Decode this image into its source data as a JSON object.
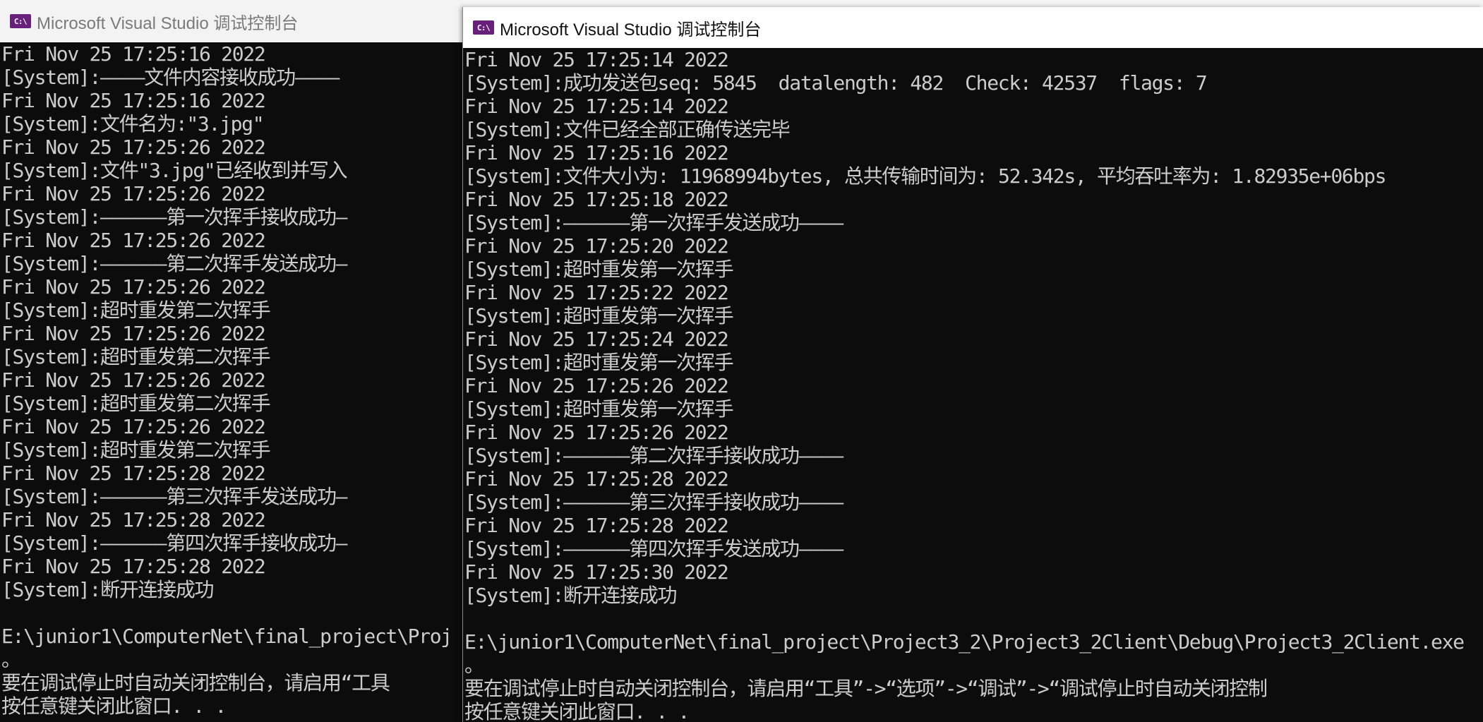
{
  "left_window": {
    "title": "Microsoft Visual Studio 调试控制台",
    "icon": "c-console-icon",
    "lines": [
      "Fri Nov 25 17:25:16 2022",
      "[System]:————文件内容接收成功————",
      "Fri Nov 25 17:25:16 2022",
      "[System]:文件名为:\"3.jpg\"",
      "Fri Nov 25 17:25:26 2022",
      "[System]:文件\"3.jpg\"已经收到并写入",
      "Fri Nov 25 17:25:26 2022",
      "[System]:——————第一次挥手接收成功—",
      "Fri Nov 25 17:25:26 2022",
      "[System]:——————第二次挥手发送成功—",
      "Fri Nov 25 17:25:26 2022",
      "[System]:超时重发第二次挥手",
      "Fri Nov 25 17:25:26 2022",
      "[System]:超时重发第二次挥手",
      "Fri Nov 25 17:25:26 2022",
      "[System]:超时重发第二次挥手",
      "Fri Nov 25 17:25:26 2022",
      "[System]:超时重发第二次挥手",
      "Fri Nov 25 17:25:28 2022",
      "[System]:——————第三次挥手发送成功—",
      "Fri Nov 25 17:25:28 2022",
      "[System]:——————第四次挥手接收成功—",
      "Fri Nov 25 17:25:28 2022",
      "[System]:断开连接成功",
      "",
      "E:\\junior1\\ComputerNet\\final_project\\Proj",
      "。",
      "要在调试停止时自动关闭控制台，请启用“工具",
      "按任意键关闭此窗口. . ."
    ]
  },
  "right_window": {
    "title": "Microsoft Visual Studio 调试控制台",
    "icon": "c-console-icon",
    "lines": [
      "Fri Nov 25 17:25:14 2022",
      "[System]:成功发送包seq: 5845  datalength: 482  Check: 42537  flags: 7",
      "Fri Nov 25 17:25:14 2022",
      "[System]:文件已经全部正确传送完毕",
      "Fri Nov 25 17:25:16 2022",
      "[System]:文件大小为: 11968994bytes, 总共传输时间为: 52.342s, 平均吞吐率为: 1.82935e+06bps",
      "Fri Nov 25 17:25:18 2022",
      "[System]:——————第一次挥手发送成功————",
      "Fri Nov 25 17:25:20 2022",
      "[System]:超时重发第一次挥手",
      "Fri Nov 25 17:25:22 2022",
      "[System]:超时重发第一次挥手",
      "Fri Nov 25 17:25:24 2022",
      "[System]:超时重发第一次挥手",
      "Fri Nov 25 17:25:26 2022",
      "[System]:超时重发第一次挥手",
      "Fri Nov 25 17:25:26 2022",
      "[System]:——————第二次挥手接收成功————",
      "Fri Nov 25 17:25:28 2022",
      "[System]:——————第三次挥手接收成功————",
      "Fri Nov 25 17:25:28 2022",
      "[System]:——————第四次挥手发送成功————",
      "Fri Nov 25 17:25:30 2022",
      "[System]:断开连接成功",
      "",
      "E:\\junior1\\ComputerNet\\final_project\\Project3_2\\Project3_2Client\\Debug\\Project3_2Client.exe",
      "。",
      "要在调试停止时自动关闭控制台，请启用“工具”->“选项”->“调试”->“调试停止时自动关闭控制",
      "按任意键关闭此窗口. . ."
    ]
  },
  "colors": {
    "console_bg": "#0c0c0c",
    "console_text": "#cccccc",
    "icon_bg": "#68217a"
  }
}
